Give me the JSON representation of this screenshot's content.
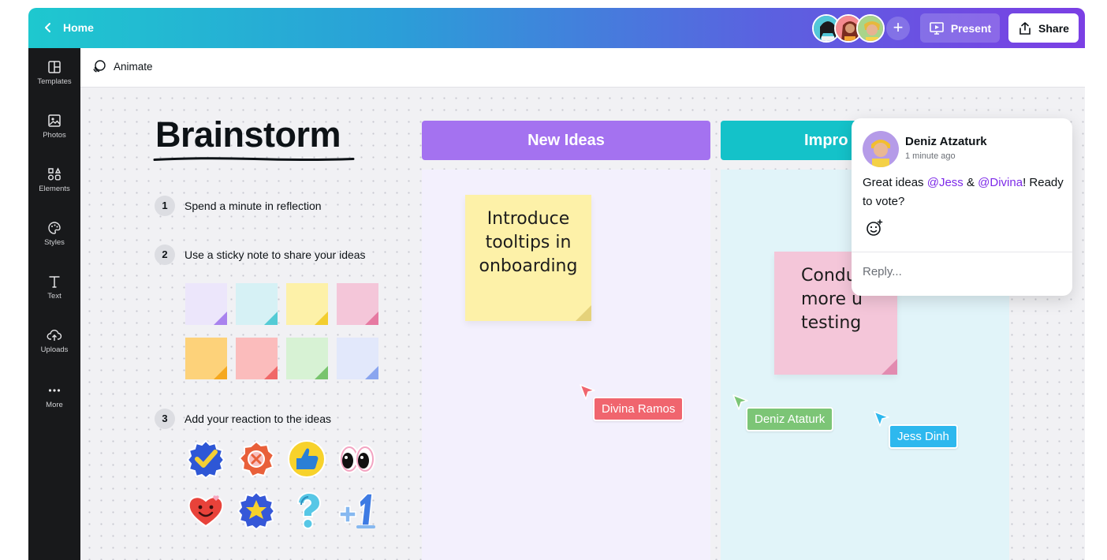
{
  "topbar": {
    "home_label": "Home",
    "present_label": "Present",
    "share_label": "Share",
    "add_label": "+"
  },
  "sidebar": {
    "items": [
      {
        "label": "Templates",
        "icon": "templates-icon"
      },
      {
        "label": "Photos",
        "icon": "photos-icon"
      },
      {
        "label": "Elements",
        "icon": "elements-icon"
      },
      {
        "label": "Styles",
        "icon": "styles-icon"
      },
      {
        "label": "Text",
        "icon": "text-icon"
      },
      {
        "label": "Uploads",
        "icon": "uploads-icon"
      },
      {
        "label": "More",
        "icon": "more-icon"
      }
    ]
  },
  "subbar": {
    "animate_label": "Animate"
  },
  "board": {
    "title": "Brainstorm",
    "steps": [
      {
        "num": "1",
        "text": "Spend a minute in reflection"
      },
      {
        "num": "2",
        "text": "Use a sticky note to share your ideas"
      },
      {
        "num": "3",
        "text": "Add your reaction to the ideas"
      }
    ],
    "columns": [
      {
        "title": "New Ideas",
        "color": "#a472f0"
      },
      {
        "title": "Impro",
        "color": "#14c2c9"
      }
    ],
    "notes": [
      {
        "text": "Introduce tooltips in onboarding"
      },
      {
        "text": "Condu more u testing"
      }
    ],
    "cursors": [
      {
        "name": "Divina Ramos",
        "color": "#f0656e"
      },
      {
        "name": "Deniz Ataturk",
        "color": "#7cc576"
      },
      {
        "name": "Jess Dinh",
        "color": "#2eb8ee"
      }
    ]
  },
  "comment": {
    "author": "Deniz Atzaturk",
    "time": "1 minute ago",
    "text_before": "Great ideas ",
    "mention1": "@Jess",
    "text_mid": " & ",
    "mention2": "@Divina",
    "text_after": "! Ready to vote?",
    "reply_placeholder": "Reply..."
  }
}
